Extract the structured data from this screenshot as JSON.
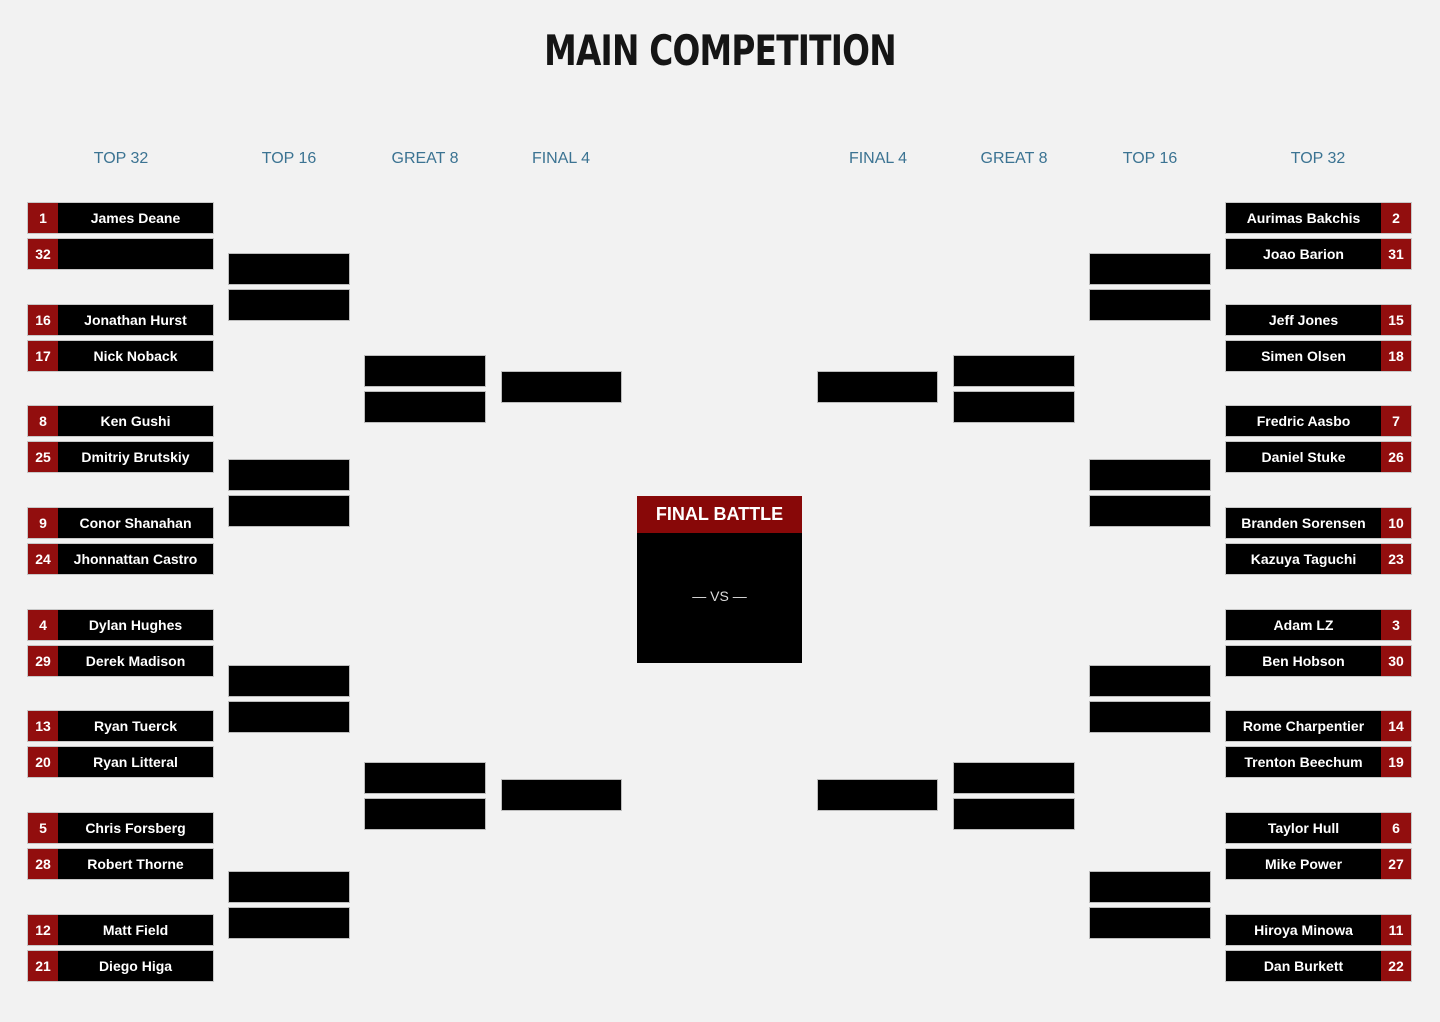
{
  "title": "MAIN COMPETITION",
  "rounds": {
    "left": [
      "TOP 32",
      "TOP 16",
      "GREAT 8",
      "FINAL 4"
    ],
    "right": [
      "FINAL 4",
      "GREAT 8",
      "TOP 16",
      "TOP 32"
    ]
  },
  "final": {
    "label": "FINAL BATTLE",
    "vs": "— VS —"
  },
  "left_top32": [
    {
      "seed": "1",
      "name": "James Deane"
    },
    {
      "seed": "32",
      "name": ""
    },
    {
      "seed": "16",
      "name": "Jonathan Hurst"
    },
    {
      "seed": "17",
      "name": "Nick Noback"
    },
    {
      "seed": "8",
      "name": "Ken Gushi"
    },
    {
      "seed": "25",
      "name": "Dmitriy Brutskiy"
    },
    {
      "seed": "9",
      "name": "Conor Shanahan"
    },
    {
      "seed": "24",
      "name": "Jhonnattan Castro"
    },
    {
      "seed": "4",
      "name": "Dylan Hughes"
    },
    {
      "seed": "29",
      "name": "Derek Madison"
    },
    {
      "seed": "13",
      "name": "Ryan Tuerck"
    },
    {
      "seed": "20",
      "name": "Ryan Litteral"
    },
    {
      "seed": "5",
      "name": "Chris Forsberg"
    },
    {
      "seed": "28",
      "name": "Robert Thorne"
    },
    {
      "seed": "12",
      "name": "Matt Field"
    },
    {
      "seed": "21",
      "name": "Diego Higa"
    }
  ],
  "right_top32": [
    {
      "seed": "2",
      "name": "Aurimas Bakchis"
    },
    {
      "seed": "31",
      "name": "Joao Barion"
    },
    {
      "seed": "15",
      "name": "Jeff Jones"
    },
    {
      "seed": "18",
      "name": "Simen Olsen"
    },
    {
      "seed": "7",
      "name": "Fredric Aasbo"
    },
    {
      "seed": "26",
      "name": "Daniel Stuke"
    },
    {
      "seed": "10",
      "name": "Branden Sorensen"
    },
    {
      "seed": "23",
      "name": "Kazuya Taguchi"
    },
    {
      "seed": "3",
      "name": "Adam LZ"
    },
    {
      "seed": "30",
      "name": "Ben Hobson"
    },
    {
      "seed": "14",
      "name": "Rome Charpentier"
    },
    {
      "seed": "19",
      "name": "Trenton Beechum"
    },
    {
      "seed": "6",
      "name": "Taylor Hull"
    },
    {
      "seed": "27",
      "name": "Mike Power"
    },
    {
      "seed": "11",
      "name": "Hiroya Minowa"
    },
    {
      "seed": "22",
      "name": "Dan Burkett"
    }
  ],
  "colors": {
    "seed": "#920e0e",
    "final_header": "#880808",
    "round_label": "#3b7392"
  }
}
